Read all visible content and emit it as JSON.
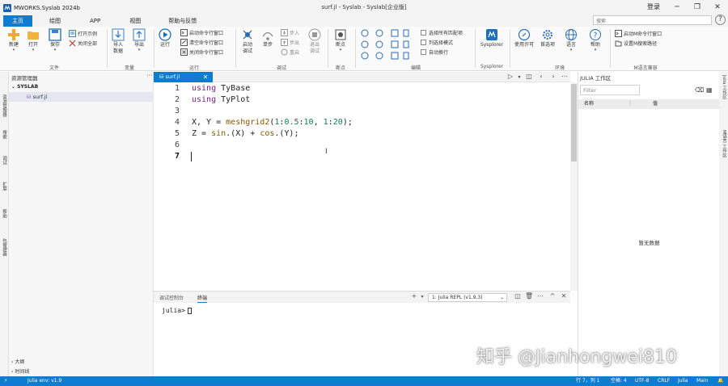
{
  "titlebar": {
    "app_title": "MWORKS.Syslab 2024b",
    "file_title": "surf.jl - Syslab - Syslab[企业版]",
    "login": "登录"
  },
  "menu": {
    "tabs": [
      "主页",
      "绘图",
      "APP",
      "视图",
      "帮助与反馈"
    ],
    "search_placeholder": "搜索"
  },
  "ribbon": {
    "file": {
      "group": "文件",
      "new": "新建",
      "open": "打开",
      "save": "保存",
      "open_examples": "打开示例",
      "close_all": "关闭全部"
    },
    "variables": {
      "group": "变量",
      "import": "导入\n数据",
      "export": "导出"
    },
    "run": {
      "group": "运行",
      "run": "运行",
      "start_cmd": "启动命令行窗口",
      "clear_cmd": "清空命令行窗口",
      "close_cmd": "关闭命令行窗口"
    },
    "debug": {
      "group": "调试",
      "start_debug": "启动\n调试",
      "step": "单步",
      "step_in": "步入",
      "step_out": "步出",
      "restart": "重启",
      "exit_debug": "退出\n调试"
    },
    "breakpoints": {
      "group": "断点",
      "breakpoint": "断点"
    },
    "edit": {
      "group": "编辑",
      "select_all_matches": "选择所有匹配项",
      "column_select": "列选择模式",
      "auto_wrap": "自动换行"
    },
    "sysplorer": {
      "group": "Sysplorer",
      "sysplorer": "Sysplorer"
    },
    "environment": {
      "group": "环境",
      "license": "使用许可",
      "preferences": "首选项",
      "language": "语言",
      "help": "帮助"
    },
    "m_compat": {
      "group": "M语言兼容",
      "start_m_cmd": "启动M命令行窗口",
      "set_m_path": "设置M搜索路径"
    }
  },
  "left_strip": [
    "资源管理器",
    "搜索",
    "调试",
    "扩展",
    "帮助",
    "包管理器"
  ],
  "explorer": {
    "title": "资源管理器",
    "more": "···",
    "root": "SYSLAB",
    "file": "surf.jl",
    "outline": "大纲",
    "timeline": "时间线"
  },
  "editor": {
    "tab_label": "surf.jl",
    "lines": [
      {
        "n": "1",
        "text": "using TyBase"
      },
      {
        "n": "2",
        "text": "using TyPlot"
      },
      {
        "n": "3",
        "text": ""
      },
      {
        "n": "4",
        "text": "X, Y = meshgrid2(1:0.5:10, 1:20);"
      },
      {
        "n": "5",
        "text": "Z = sin.(X) + cos.(Y);"
      },
      {
        "n": "6",
        "text": ""
      },
      {
        "n": "7",
        "text": ""
      }
    ]
  },
  "terminal": {
    "tab_debug_console": "调试控制台",
    "tab_terminal": "终端",
    "repl_select": "1: Julia REPL (v1.9.3)",
    "prompt": "julia>"
  },
  "right_panel": {
    "title": "JULIA 工作区",
    "filter_placeholder": "Filter",
    "col_name": "名称",
    "col_value": "值",
    "empty": "暂无数据"
  },
  "right_strip": [
    "Julia 工作区",
    "M语言 工作区"
  ],
  "watermark": "知乎 @Jianhongwei810",
  "statusbar": {
    "env": "Julia env: v1.9",
    "position": "行 7，列 1",
    "spaces": "空格: 4",
    "encoding": "UTF-8",
    "eol": "CRLF",
    "language": "Julia",
    "branch": "Main"
  },
  "colors": {
    "accent": "#0e7cd0",
    "keyword": "#7a1f91",
    "number": "#0b7d55"
  }
}
